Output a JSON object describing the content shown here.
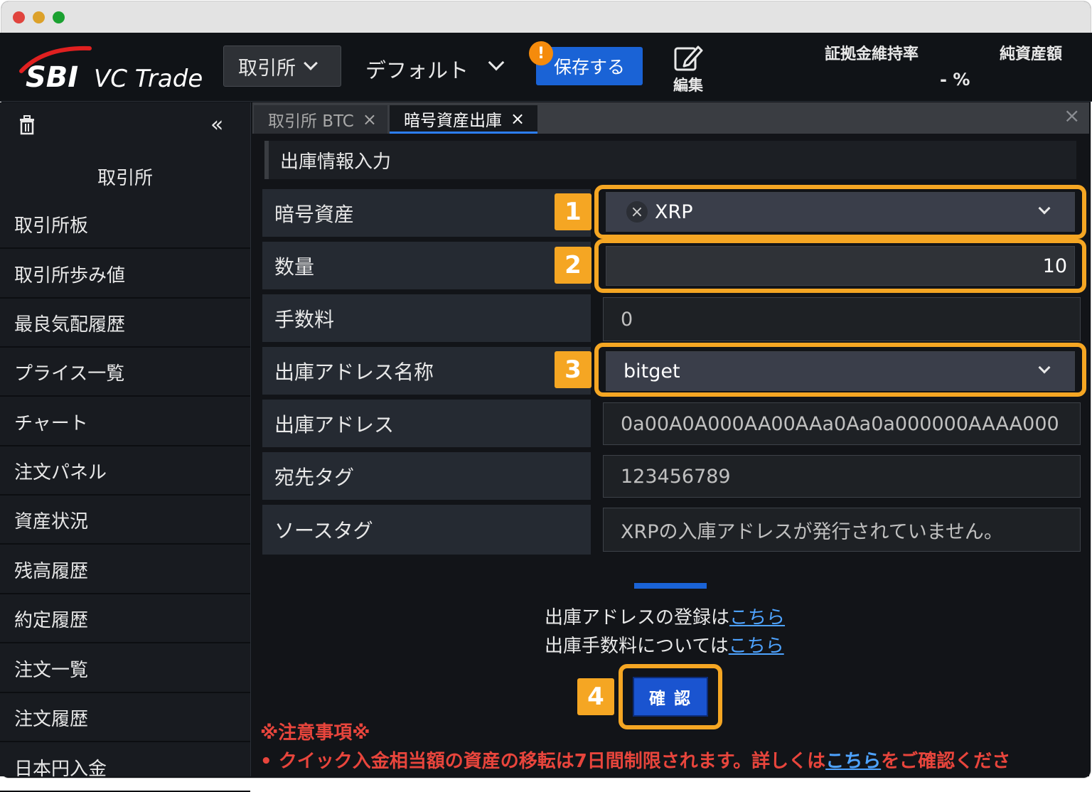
{
  "header": {
    "logo_sbi": "SBI",
    "logo_vc": "VC Trade",
    "exchange_button": "取引所",
    "layout_name": "デフォルト",
    "save_button": "保存する",
    "alert_badge": "!",
    "edit_label": "編集",
    "margin_ratio_label": "証拠金維持率",
    "margin_ratio_value": "- %",
    "net_assets_label": "純資産額"
  },
  "sidebar": {
    "title": "取引所",
    "items": [
      {
        "label": "取引所板"
      },
      {
        "label": "取引所歩み値"
      },
      {
        "label": "最良気配履歴"
      },
      {
        "label": "プライス一覧"
      },
      {
        "label": "チャート"
      },
      {
        "label": "注文パネル"
      },
      {
        "label": "資産状況"
      },
      {
        "label": "残高履歴"
      },
      {
        "label": "約定履歴"
      },
      {
        "label": "注文一覧"
      },
      {
        "label": "注文履歴"
      },
      {
        "label": "日本円入金"
      }
    ]
  },
  "tabs": [
    {
      "label": "取引所 BTC",
      "active": false
    },
    {
      "label": "暗号資産出庫",
      "active": true
    }
  ],
  "form": {
    "section_title": "出庫情報入力",
    "rows": [
      {
        "label": "暗号資産",
        "value": "XRP"
      },
      {
        "label": "数量",
        "value": "10"
      },
      {
        "label": "手数料",
        "value": "0"
      },
      {
        "label": "出庫アドレス名称",
        "value": "bitget"
      },
      {
        "label": "出庫アドレス",
        "value": "0a00A0A000AA00AAa0Aa0a000000AAAA000"
      },
      {
        "label": "宛先タグ",
        "value": "123456789"
      },
      {
        "label": "ソースタグ",
        "value": "XRPの入庫アドレスが発行されていません。"
      }
    ]
  },
  "steps": [
    "1",
    "2",
    "3",
    "4"
  ],
  "info": {
    "line1_text": "出庫アドレスの登録は",
    "line1_link": "こちら",
    "line2_text": "出庫手数料については",
    "line2_link": "こちら"
  },
  "confirm_button": "確 認",
  "notes": {
    "title": "※注意事項※",
    "bullet": "•",
    "line_text": "クイック入金相当額の資産の移転は7日間制限されます。詳しくは",
    "line_link": "こちら",
    "line_suffix": "をご確認くださ"
  },
  "colors": {
    "highlight": "#f5a623",
    "primary_button": "#1a63d6",
    "warning_text": "#e8453c",
    "link": "#4ea3ff"
  }
}
